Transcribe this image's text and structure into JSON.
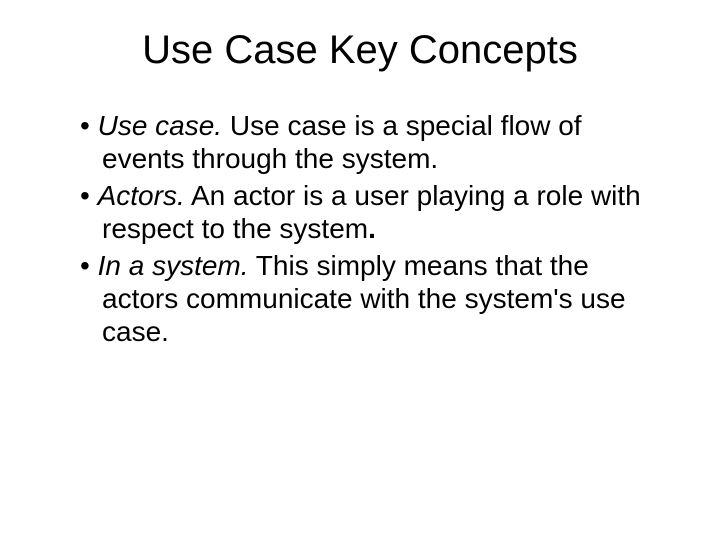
{
  "title": "Use Case Key Concepts",
  "bullets": [
    {
      "term": "Use case.",
      "text": " Use case is a special flow of events through the system."
    },
    {
      "term": "Actors.",
      "text": " An actor is a user playing a role with respect to the system",
      "trailing_dot": "."
    },
    {
      "term": "In a system.",
      "text": " This simply means that the actors communicate with the system's use case."
    }
  ]
}
